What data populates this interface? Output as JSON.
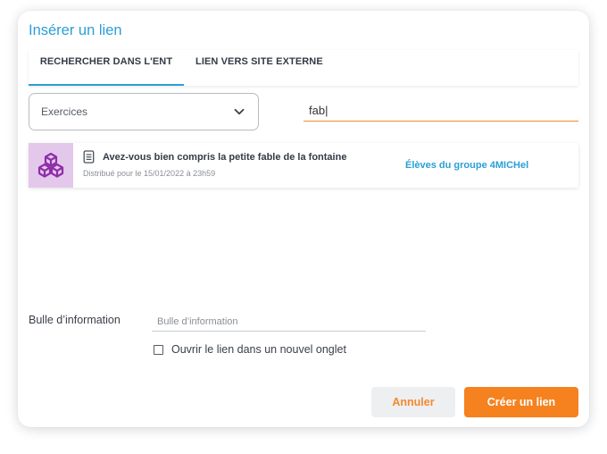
{
  "dialog": {
    "title": "Insérer un lien"
  },
  "tabs": [
    {
      "label": "RECHERCHER DANS L'ENT",
      "active": true
    },
    {
      "label": "LIEN VERS SITE EXTERNE",
      "active": false
    }
  ],
  "filter": {
    "selected": "Exercices",
    "icon": "chevron-down-icon"
  },
  "search": {
    "value": "fab|"
  },
  "results": [
    {
      "title": "Avez-vous bien compris la petite fable de la fontaine",
      "subtitle": "Distribué pour le 15/01/2022 à 23h59",
      "group": "Élèves du groupe 4MICHel",
      "thumb_color": "#e4c8ec",
      "thumb_icon": "cubes-icon",
      "type_icon": "document-icon"
    }
  ],
  "tooltip": {
    "label": "Bulle d’information",
    "placeholder": "Bulle d’information",
    "value": ""
  },
  "new_tab": {
    "label": "Ouvrir le lien dans un nouvel onglet",
    "checked": false
  },
  "actions": {
    "cancel_label": "Annuler",
    "create_label": "Créer un lien"
  },
  "colors": {
    "accent_blue": "#2a9fd6",
    "accent_orange": "#f5821f",
    "thumb_purple": "#8e2ea8"
  }
}
